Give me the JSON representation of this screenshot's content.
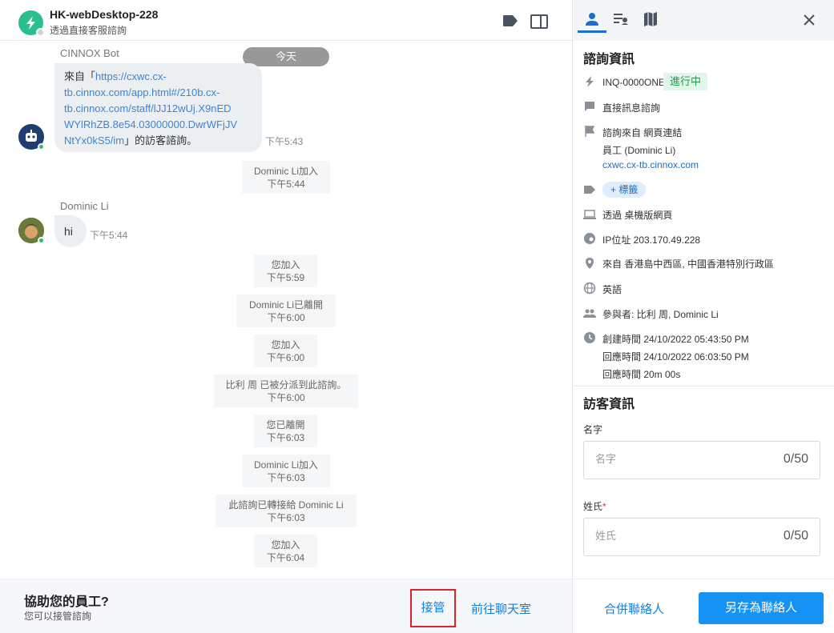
{
  "header": {
    "title": "HK-webDesktop-228",
    "subtitle": "透過直接客服諮詢"
  },
  "chat": {
    "date_divider": "今天",
    "bot_message": {
      "sender": "CINNOX Bot",
      "prefix": "來自「",
      "line1": "https://cxwc.cx-",
      "line2": "tb.cinnox.com/app.html#/210b.cx-",
      "line3": "tb.cinnox.com/staff/lJJ12wUj.X9nED",
      "line4": "WYlRhZB.8e54.03000000.DwrWFjJV",
      "line5_link": "NtYx0kS5/im",
      "suffix": "」的訪客諮詢。",
      "time": "下午5:43"
    },
    "user_message": {
      "sender": "Dominic Li",
      "text": "hi",
      "time": "下午5:44"
    },
    "system_events": [
      {
        "text": "Dominic Li加入",
        "time": "下午5:44"
      },
      {
        "text": "您加入",
        "time": "下午5:59"
      },
      {
        "text": "Dominic Li已離開",
        "time": "下午6:00"
      },
      {
        "text": "您加入",
        "time": "下午6:00"
      },
      {
        "text": "比利 周 已被分派到此諮詢。",
        "time": "下午6:00"
      },
      {
        "text": "您已離開",
        "time": "下午6:03"
      },
      {
        "text": "Dominic Li加入",
        "time": "下午6:03"
      },
      {
        "text": "此諮詢已轉接給 Dominic Li",
        "time": "下午6:03"
      },
      {
        "text": "您加入",
        "time": "下午6:04"
      }
    ]
  },
  "bottom_bar": {
    "title": "協助您的員工?",
    "subtitle": "您可以接管諮詢",
    "takeover": "接管",
    "goto_chat": "前往聊天室"
  },
  "inquiry": {
    "section_title": "諮詢資訊",
    "id": "INQ-0000ONE",
    "status": "進行中",
    "type": "直接訊息諮詢",
    "source": "諮詢來自 網頁連結",
    "staff": "員工 (Dominic Li)",
    "domain": "cxwc.cx-tb.cinnox.com",
    "tag_button": "+ 標籤",
    "channel": "透過 桌機版網頁",
    "ip": "IP位址 203.170.49.228",
    "location": "來自 香港島中西區, 中國香港特別行政區",
    "language": "英語",
    "participants": "參與者: 比利 周, Dominic Li",
    "created": "創建時間 24/10/2022 05:43:50 PM",
    "responded": "回應時間 24/10/2022 06:03:50 PM",
    "response_time": "回應時間 20m 00s"
  },
  "visitor": {
    "section_title": "訪客資訊",
    "first_name_label": "名字",
    "first_name_placeholder": "名字",
    "first_name_count": "0/50",
    "last_name_label": "姓氏",
    "last_name_required": "*",
    "last_name_placeholder": "姓氏",
    "last_name_count": "0/50"
  },
  "right_bottom": {
    "merge": "合併聯絡人",
    "save": "另存為聯絡人"
  },
  "colors": {
    "accent": "#1691f4",
    "link": "#1e6fc4",
    "status_green": "#16a04a",
    "takeover_highlight": "#d9232d",
    "brand_green": "#2bbf8c"
  },
  "icons": {
    "tabs": [
      "person-icon",
      "list-icon",
      "map-icon"
    ],
    "header": [
      "tag-icon",
      "panel-icon",
      "close-icon"
    ]
  }
}
